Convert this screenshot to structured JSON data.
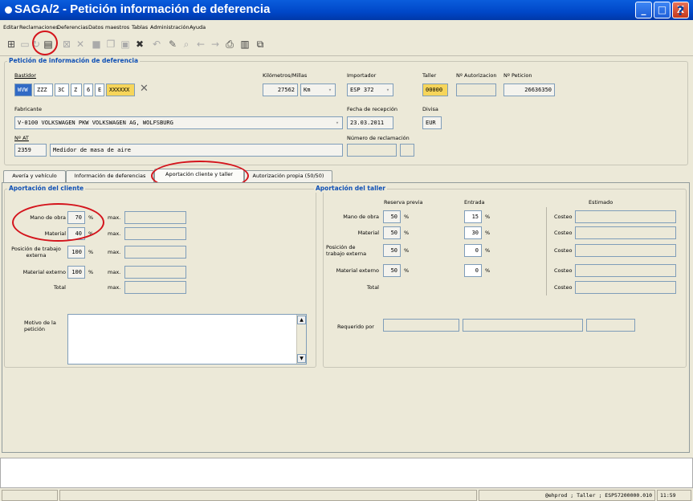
{
  "window": {
    "title": "SAGA/2 - Petición información de deferencia",
    "buttons": {
      "minimize": "_",
      "maximize": "□",
      "close": "X"
    }
  },
  "menu": [
    "Editar",
    "Reclamaciones",
    "Deferencias",
    "Datos maestros",
    "Tablas",
    "Administración",
    "Ayuda"
  ],
  "toolbar": {
    "icons": [
      "new-icon",
      "open-icon",
      "refresh-icon",
      "document-icon",
      "export-icon",
      "delete-icon",
      "save-icon",
      "copy-icon",
      "paste-icon",
      "cancel-icon",
      "undo-icon",
      "edit-icon",
      "search-icon",
      "back-icon",
      "forward-icon",
      "print-icon",
      "grid-icon",
      "window-icon"
    ],
    "help": "?"
  },
  "header": {
    "group_title": "Petición de información de deferencia",
    "bastidor": {
      "label": "Bastidor",
      "parts": [
        "WVW",
        "ZZZ",
        "3C",
        "Z",
        "6",
        "E",
        "XXXXXX"
      ]
    },
    "kilometros": {
      "label": "Kilómetros/Millas",
      "value": "27562",
      "unit": "Km"
    },
    "importador": {
      "label": "Importador",
      "value": "ESP 372"
    },
    "taller": {
      "label": "Taller",
      "value": "00000"
    },
    "autorizacion": {
      "label": "Nº Autorizacion",
      "value": ""
    },
    "peticion": {
      "label": "Nº Peticion",
      "value": "26636350"
    },
    "fabricante": {
      "label": "Fabricante",
      "value": "V-0100 VOLKSWAGEN PKW VOLKSWAGEN AG, WOLFSBURG"
    },
    "fecha": {
      "label": "Fecha de recepción",
      "value": "23.03.2011"
    },
    "divisa": {
      "label": "Divisa",
      "value": "EUR"
    },
    "nat": {
      "label": "Nº AT",
      "code": "2359",
      "value": "Medidor de masa de aire"
    },
    "reclamacion": {
      "label": "Número de reclamación",
      "value1": "",
      "value2": ""
    }
  },
  "tabs": [
    "Avería y vehículo",
    "Información de deferencias",
    "Aportación cliente y taller",
    "Autorización propia (50/50)"
  ],
  "cliente": {
    "title": "Aportación del cliente",
    "rows": [
      {
        "label": "Mano de obra",
        "pct": "70",
        "sign": "%",
        "max": "max."
      },
      {
        "label": "Material",
        "pct": "40",
        "sign": "%",
        "max": "max."
      },
      {
        "label": "Posición de trabajo externa",
        "pct": "100",
        "sign": "%",
        "max": "max."
      },
      {
        "label": "Material externo",
        "pct": "100",
        "sign": "%",
        "max": "max."
      },
      {
        "label": "Total",
        "pct": "",
        "sign": "",
        "max": "max."
      }
    ],
    "motivo_label": "Motivo de la petición",
    "motivo_value": ""
  },
  "taller": {
    "title": "Aportación del taller",
    "col_reserva": "Reserva previa",
    "col_entrada": "Entrada",
    "col_estimado": "Estimado",
    "rows": [
      {
        "label": "Mano de obra",
        "reserva": "50",
        "entrada": "15",
        "costeo": "Costeo"
      },
      {
        "label": "Material",
        "reserva": "50",
        "entrada": "30",
        "costeo": "Costeo"
      },
      {
        "label": "Posición de trabajo externa",
        "reserva": "50",
        "entrada": "0",
        "costeo": "Costeo"
      },
      {
        "label": "Material externo",
        "reserva": "50",
        "entrada": "0",
        "costeo": "Costeo"
      },
      {
        "label": "Total",
        "reserva": "",
        "entrada": "",
        "costeo": "Costeo"
      }
    ],
    "pct": "%",
    "requerido_label": "Requerido por"
  },
  "status": {
    "user": "@ehprod ; Taller ; ESP57200000.010",
    "time": "11:59"
  },
  "colors": {
    "title_bar": "#0A5DDC",
    "group_title": "#0E4FB5",
    "annotation": "#D4141C"
  }
}
